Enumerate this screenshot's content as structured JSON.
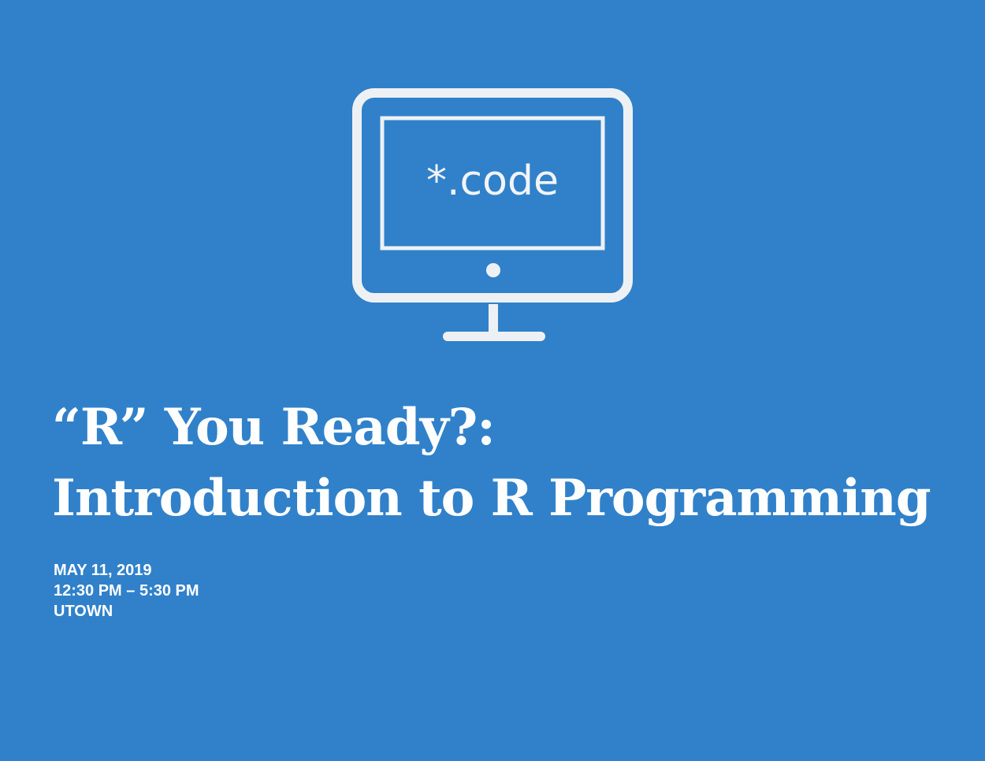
{
  "monitor": {
    "icon": "monitor-icon",
    "screen_text": "*.code"
  },
  "title": {
    "line1": "“R” You Ready?:",
    "line2": "Introduction to R Programming"
  },
  "event": {
    "date": "MAY 11, 2019",
    "time": "12:30 PM – 5:30 PM",
    "location": "UTOWN"
  },
  "colors": {
    "background": "#3081ca",
    "foreground": "#ffffff"
  }
}
